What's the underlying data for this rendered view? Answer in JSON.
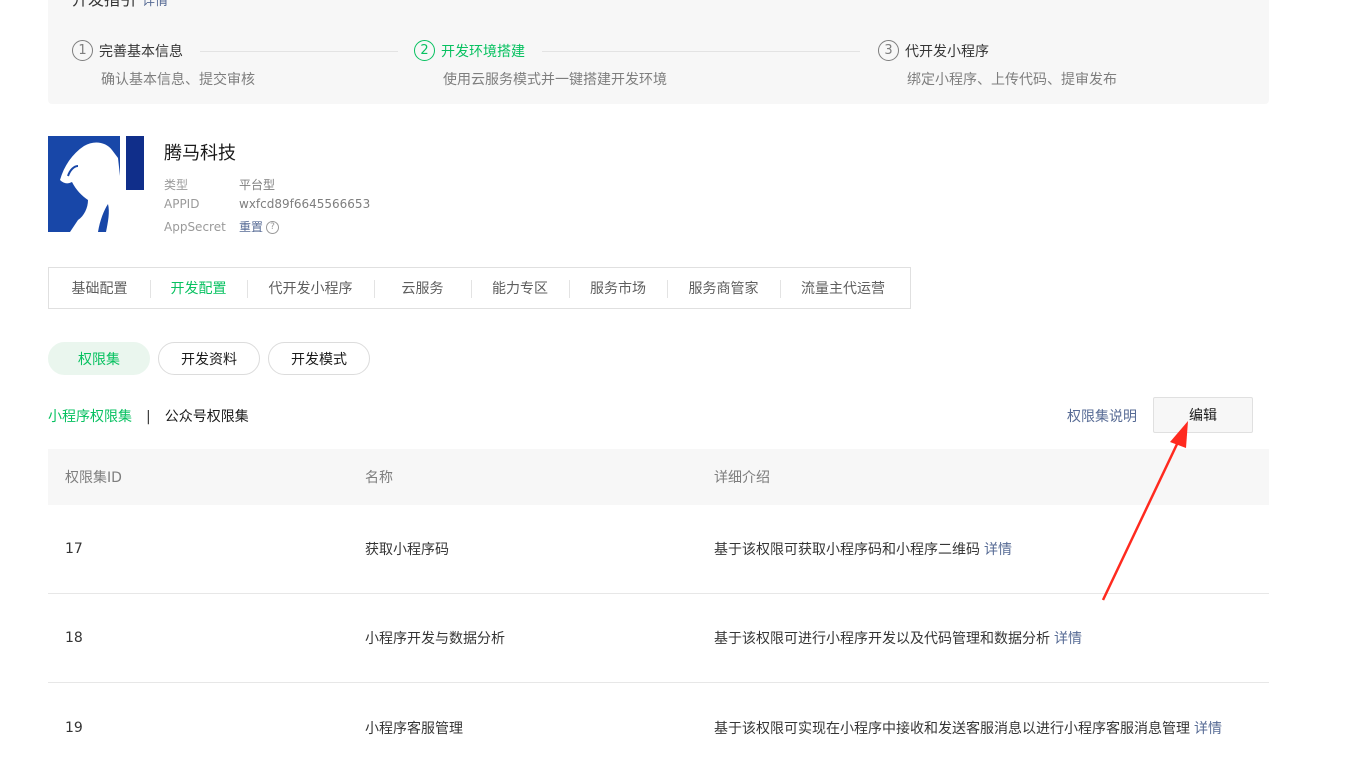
{
  "guide": {
    "title": "开发指引",
    "title_link": "详情",
    "close_icon": "×",
    "steps": [
      {
        "num": "1",
        "label": "完善基本信息",
        "desc": "确认基本信息、提交审核",
        "active": false
      },
      {
        "num": "2",
        "label": "开发环境搭建",
        "desc": "使用云服务模式并一键搭建开发环境",
        "active": true
      },
      {
        "num": "3",
        "label": "代开发小程序",
        "desc": "绑定小程序、上传代码、提审发布",
        "active": false
      }
    ]
  },
  "app": {
    "name": "腾马科技",
    "type_label": "类型",
    "type_value": "平台型",
    "appid_label": "APPID",
    "appid_value": "wxfcd89f6645566653",
    "secret_label": "AppSecret",
    "secret_action": "重置",
    "help_icon": "?",
    "logo_colors": {
      "bg": "#1847a8",
      "dark": "#102e8a"
    }
  },
  "tabs": [
    "基础配置",
    "开发配置",
    "代开发小程序",
    "云服务",
    "能力专区",
    "服务市场",
    "服务商管家",
    "流量主代运营"
  ],
  "active_tab": 1,
  "pills": [
    "权限集",
    "开发资料",
    "开发模式"
  ],
  "subtabs": {
    "mini": "小程序权限集",
    "separator": "|",
    "official": "公众号权限集"
  },
  "actions": {
    "explain": "权限集说明",
    "edit": "编辑"
  },
  "table": {
    "headers": [
      "权限集ID",
      "名称",
      "详细介绍"
    ],
    "detail_link": "详情",
    "rows": [
      {
        "id": "17",
        "name": "获取小程序码",
        "desc": "基于该权限可获取小程序码和小程序二维码"
      },
      {
        "id": "18",
        "name": "小程序开发与数据分析",
        "desc": "基于该权限可进行小程序开发以及代码管理和数据分析"
      },
      {
        "id": "19",
        "name": "小程序客服管理",
        "desc": "基于该权限可实现在小程序中接收和发送客服消息以进行小程序客服消息管理"
      }
    ]
  },
  "colors": {
    "accent": "#07c160",
    "link": "#576b95",
    "annotation": "#ff2a1f"
  }
}
